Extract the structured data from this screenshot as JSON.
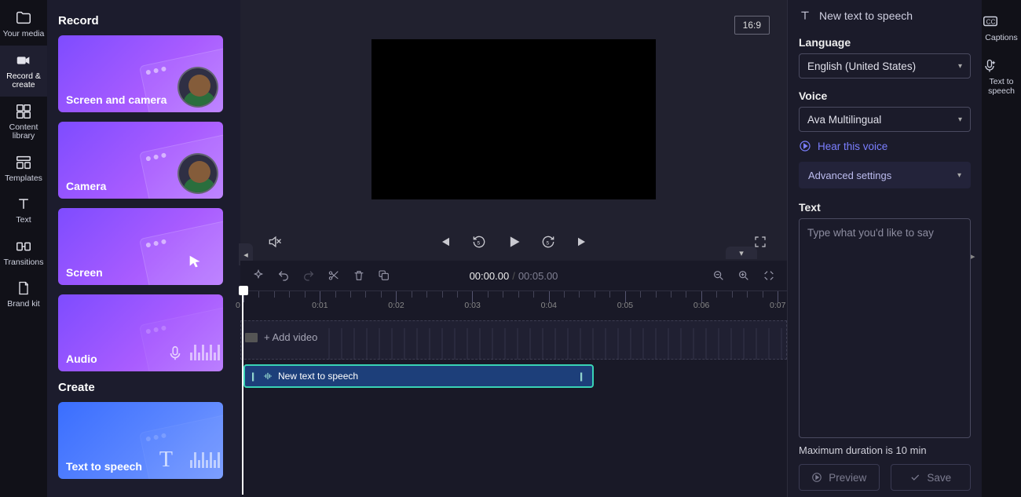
{
  "leftRail": {
    "items": [
      {
        "label": "Your media"
      },
      {
        "label": "Record & create"
      },
      {
        "label": "Content library"
      },
      {
        "label": "Templates"
      },
      {
        "label": "Text"
      },
      {
        "label": "Transitions"
      },
      {
        "label": "Brand kit"
      }
    ],
    "activeIndex": 1
  },
  "panel": {
    "recordHeading": "Record",
    "createHeading": "Create",
    "cards": {
      "screenAndCamera": "Screen and camera",
      "camera": "Camera",
      "screen": "Screen",
      "audio": "Audio",
      "textToSpeech": "Text to speech"
    }
  },
  "preview": {
    "aspect": "16:9",
    "currentTime": "00:00.00",
    "duration": "00:05.00"
  },
  "timeline": {
    "ticks": [
      "0",
      "0:01",
      "0:02",
      "0:03",
      "0:04",
      "0:05",
      "0:06",
      "0:07"
    ],
    "addVideo": "+ Add video",
    "clipLabel": "New text to speech"
  },
  "side": {
    "headerTitle": "New text to speech",
    "languageLabel": "Language",
    "languageValue": "English (United States)",
    "voiceLabel": "Voice",
    "voiceValue": "Ava Multilingual",
    "hearVoice": "Hear this voice",
    "advanced": "Advanced settings",
    "textLabel": "Text",
    "textPlaceholder": "Type what you'd like to say",
    "maxDuration": "Maximum duration is 10 min",
    "preview": "Preview",
    "save": "Save"
  },
  "rightRail": {
    "captions": "Captions",
    "tts": "Text to speech"
  }
}
